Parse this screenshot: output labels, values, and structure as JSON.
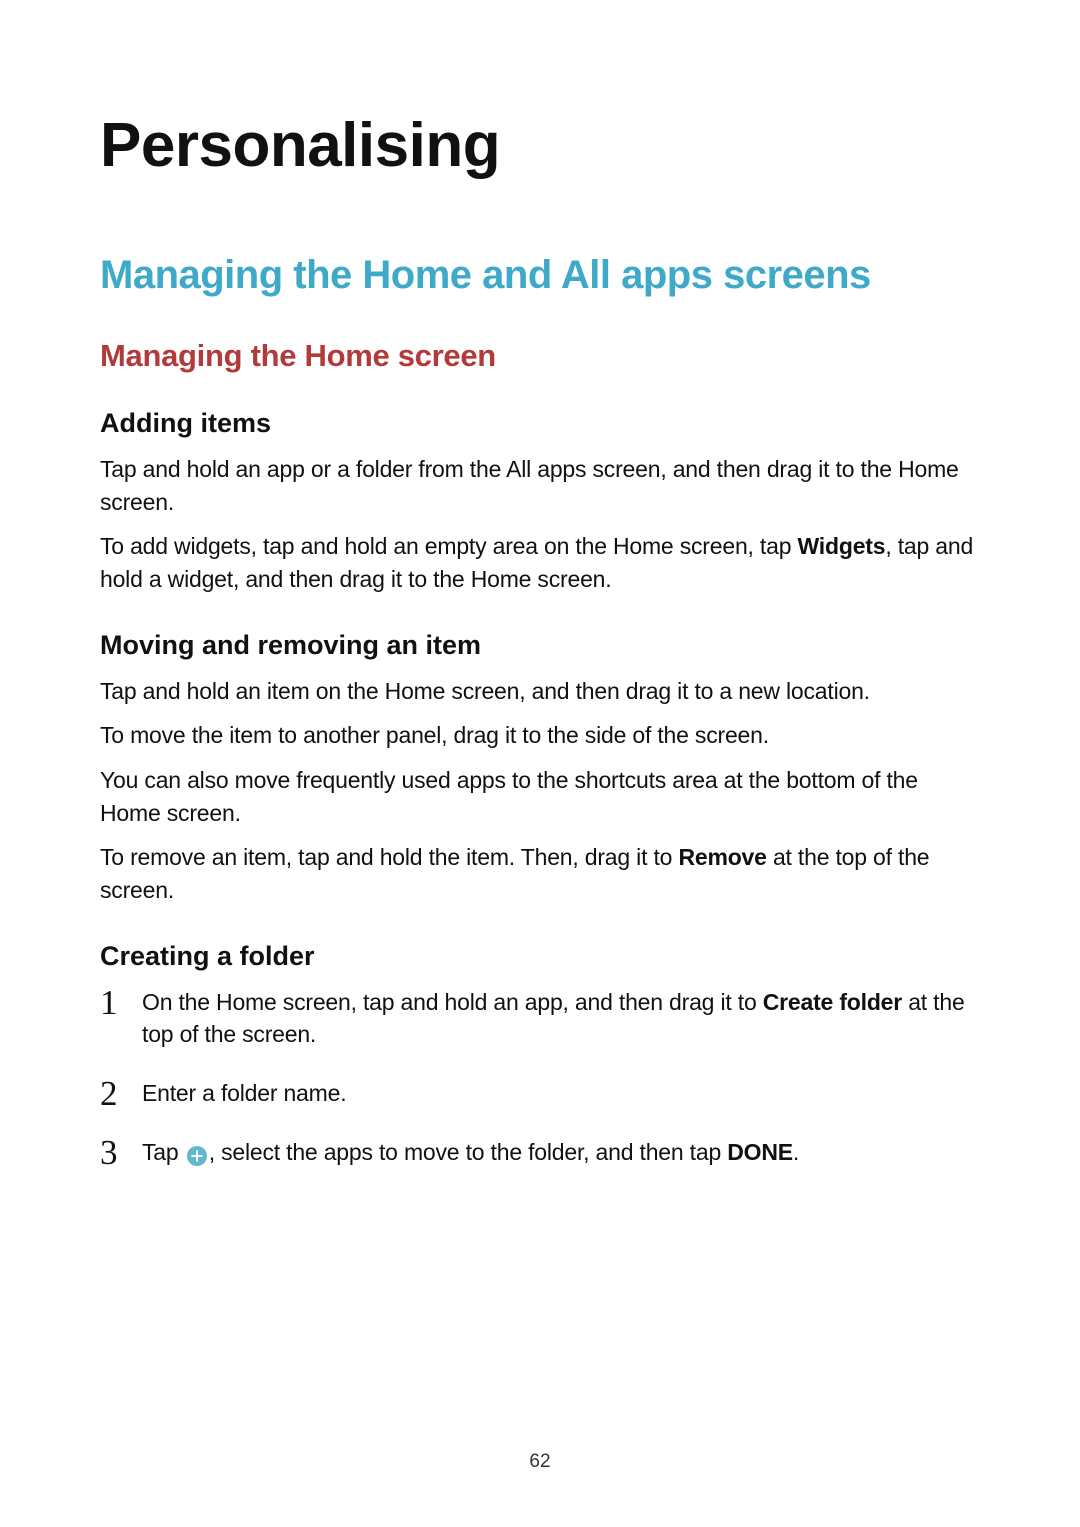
{
  "chapter": "Personalising",
  "section": "Managing the Home and All apps screens",
  "subsection": "Managing the Home screen",
  "adding": {
    "heading": "Adding items",
    "p1": "Tap and hold an app or a folder from the All apps screen, and then drag it to the Home screen.",
    "p2a": "To add widgets, tap and hold an empty area on the Home screen, tap ",
    "p2_bold": "Widgets",
    "p2b": ", tap and hold a widget, and then drag it to the Home screen."
  },
  "moving": {
    "heading": "Moving and removing an item",
    "p1": "Tap and hold an item on the Home screen, and then drag it to a new location.",
    "p2": "To move the item to another panel, drag it to the side of the screen.",
    "p3": "You can also move frequently used apps to the shortcuts area at the bottom of the Home screen.",
    "p4a": "To remove an item, tap and hold the item. Then, drag it to ",
    "p4_bold": "Remove",
    "p4b": " at the top of the screen."
  },
  "folder": {
    "heading": "Creating a folder",
    "s1a": "On the Home screen, tap and hold an app, and then drag it to ",
    "s1_bold": "Create folder",
    "s1b": " at the top of the screen.",
    "s2": "Enter a folder name.",
    "s3a": "Tap ",
    "s3b": ", select the apps to move to the folder, and then tap ",
    "s3_bold": "DONE",
    "s3c": "."
  },
  "pageNumber": "62"
}
